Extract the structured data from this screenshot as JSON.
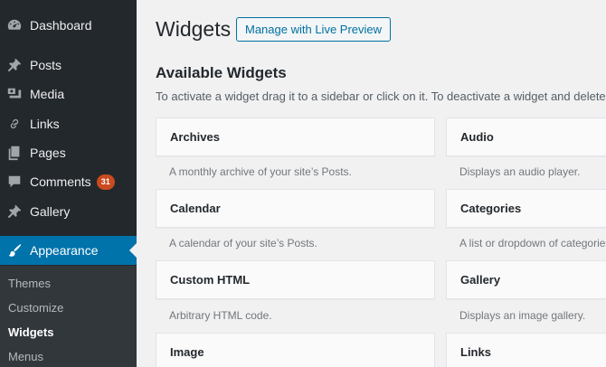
{
  "sidebar": {
    "items": [
      {
        "label": "Dashboard",
        "icon": "dashboard-icon"
      },
      {
        "label": "Posts",
        "icon": "pushpin-icon"
      },
      {
        "label": "Media",
        "icon": "media-icon"
      },
      {
        "label": "Links",
        "icon": "link-icon"
      },
      {
        "label": "Pages",
        "icon": "pages-icon"
      },
      {
        "label": "Comments",
        "icon": "comment-icon",
        "badge": "31"
      },
      {
        "label": "Gallery",
        "icon": "pushpin-icon"
      },
      {
        "label": "Appearance",
        "icon": "paintbrush-icon",
        "active": true
      }
    ],
    "submenu": [
      {
        "label": "Themes"
      },
      {
        "label": "Customize"
      },
      {
        "label": "Widgets",
        "current": true
      },
      {
        "label": "Menus"
      }
    ]
  },
  "header": {
    "title": "Widgets",
    "live_preview_label": "Manage with Live Preview"
  },
  "available": {
    "title": "Available Widgets",
    "instructions": "To activate a widget drag it to a sidebar or click on it. To deactivate a widget and delete its"
  },
  "widgets_left": [
    {
      "name": "Archives",
      "desc": "A monthly archive of your site’s Posts."
    },
    {
      "name": "Calendar",
      "desc": "A calendar of your site’s Posts."
    },
    {
      "name": "Custom HTML",
      "desc": "Arbitrary HTML code."
    },
    {
      "name": "Image",
      "desc": ""
    }
  ],
  "widgets_right": [
    {
      "name": "Audio",
      "desc": "Displays an audio player."
    },
    {
      "name": "Categories",
      "desc": "A list or dropdown of categories."
    },
    {
      "name": "Gallery",
      "desc": "Displays an image gallery."
    },
    {
      "name": "Links",
      "desc": ""
    }
  ],
  "colors": {
    "sidebar_bg": "#23282d",
    "submenu_bg": "#32373c",
    "active_bg": "#0073aa",
    "badge_bg": "#ca4a1f",
    "page_bg": "#f1f1f1",
    "button_border": "#0071a1"
  }
}
